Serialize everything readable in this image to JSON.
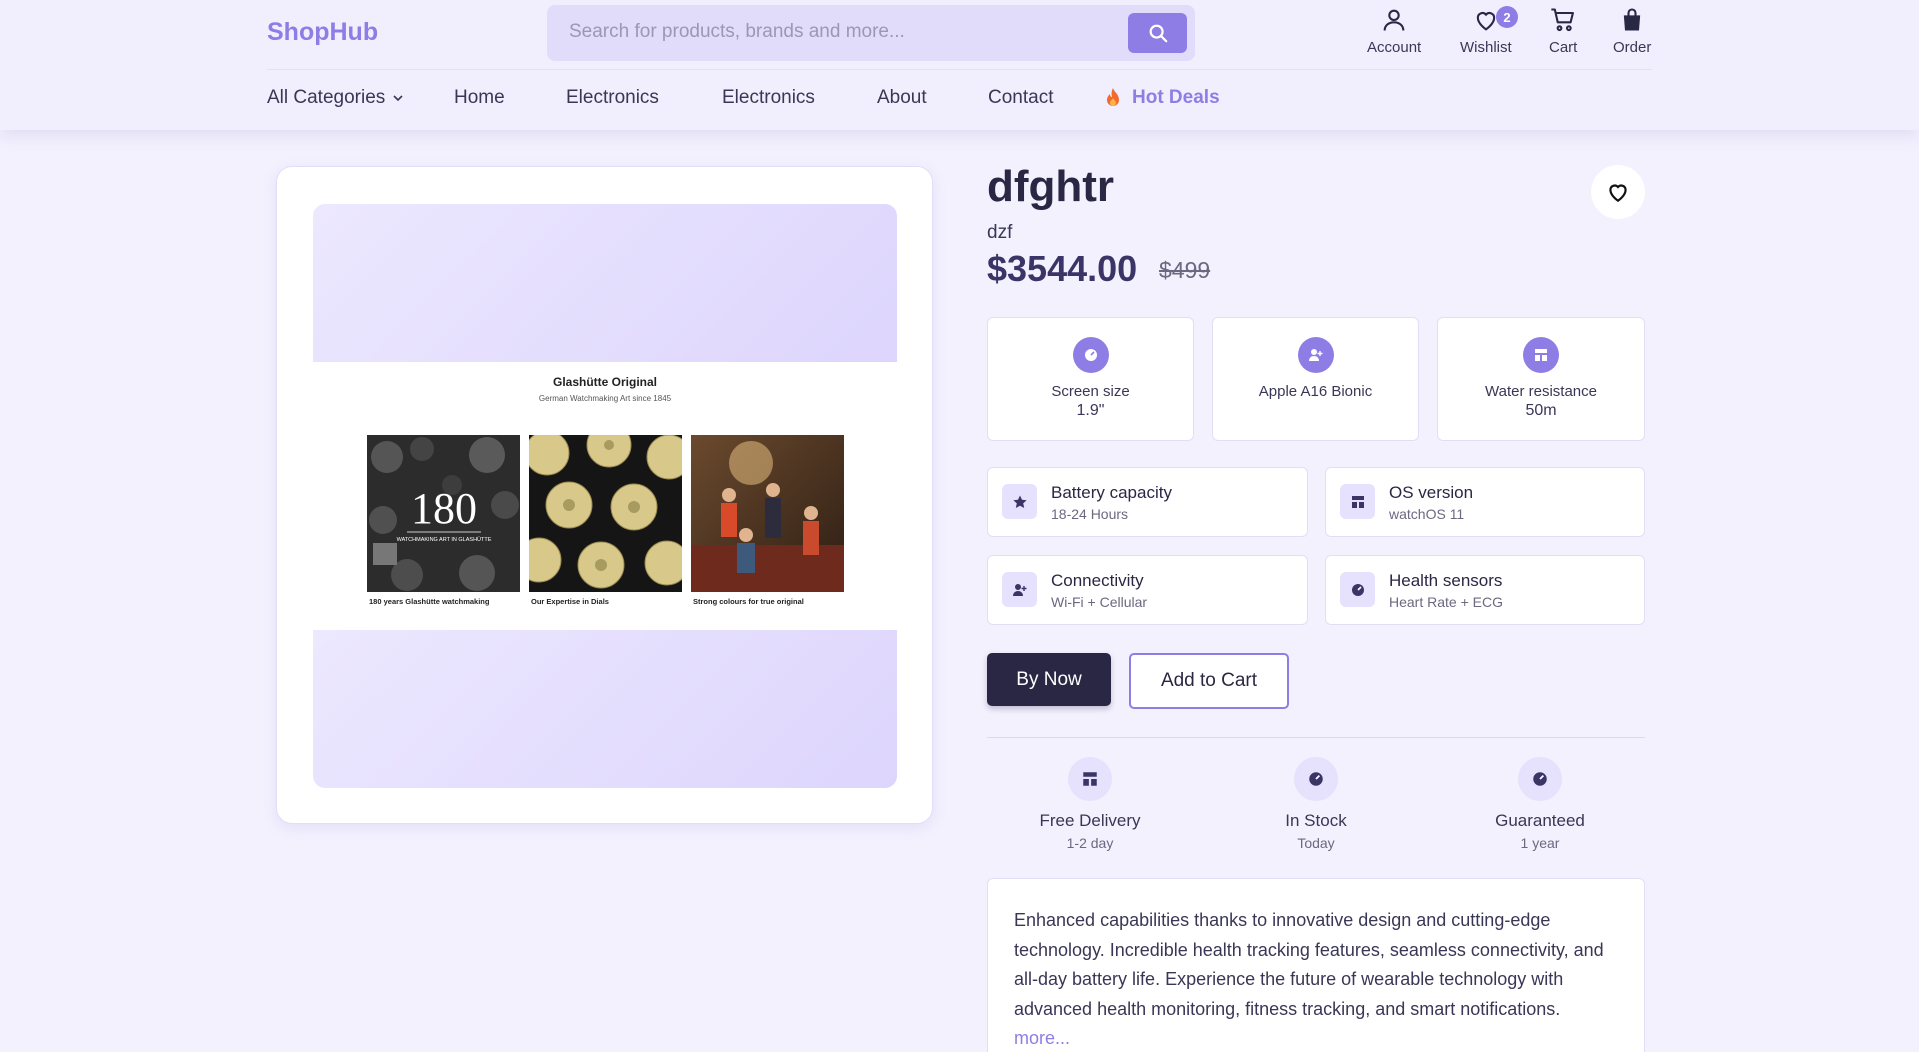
{
  "header": {
    "logo": "ShopHub",
    "search_placeholder": "Search for products, brands and more...",
    "utilities": [
      {
        "label": "Account",
        "icon": "user-icon"
      },
      {
        "label": "Wishlist",
        "icon": "heart-icon",
        "badge": "2"
      },
      {
        "label": "Cart",
        "icon": "cart-icon"
      },
      {
        "label": "Order",
        "icon": "bag-icon"
      }
    ]
  },
  "nav": {
    "categories": "All Categories",
    "items": [
      "Home",
      "Electronics",
      "Electronics",
      "About",
      "Contact"
    ],
    "hot_deals": "Hot Deals"
  },
  "gallery": {
    "brand_title": "Glashütte Original",
    "brand_subtitle": "German Watchmaking Art since 1845",
    "logo_number": "180",
    "logo_tagline": "WATCHMAKING ART IN GLASHÜTTE",
    "captions": [
      "180 years Glashütte watchmaking",
      "Our Expertise in Dials",
      "Strong colours for true original"
    ]
  },
  "product": {
    "title": "dfghtr",
    "subtitle": "dzf",
    "price": "$3544.00",
    "old_price": "$499"
  },
  "specs": [
    {
      "label": "Screen size",
      "value": "1.9\"",
      "icon": "gauge-icon"
    },
    {
      "label": "Apple A16 Bionic",
      "value": "",
      "icon": "user-plus-icon"
    },
    {
      "label": "Water resistance",
      "value": "50m",
      "icon": "layout-icon"
    }
  ],
  "features": [
    {
      "label": "Battery capacity",
      "value": "18-24 Hours",
      "icon": "star-icon"
    },
    {
      "label": "OS version",
      "value": "watchOS 11",
      "icon": "layout-icon"
    },
    {
      "label": "Connectivity",
      "value": "Wi-Fi + Cellular",
      "icon": "user-plus-icon"
    },
    {
      "label": "Health sensors",
      "value": "Heart Rate + ECG",
      "icon": "gauge-icon"
    }
  ],
  "actions": {
    "buy_now": "By Now",
    "add_to_cart": "Add to Cart"
  },
  "perks": [
    {
      "label": "Free Delivery",
      "value": "1-2 day",
      "icon": "layout-icon"
    },
    {
      "label": "In Stock",
      "value": "Today",
      "icon": "gauge-icon"
    },
    {
      "label": "Guaranteed",
      "value": "1 year",
      "icon": "gauge-icon"
    }
  ],
  "description": {
    "text": "Enhanced capabilities thanks to innovative design and cutting-edge technology. Incredible health tracking features, seamless connectivity, and all-day battery life. Experience the future of wearable technology with advanced health monitoring, fitness tracking, and smart notifications.",
    "more_label": "more..."
  },
  "colors": {
    "accent": "#8f7de6",
    "dark": "#2a2744",
    "background": "#f3f1fe"
  }
}
